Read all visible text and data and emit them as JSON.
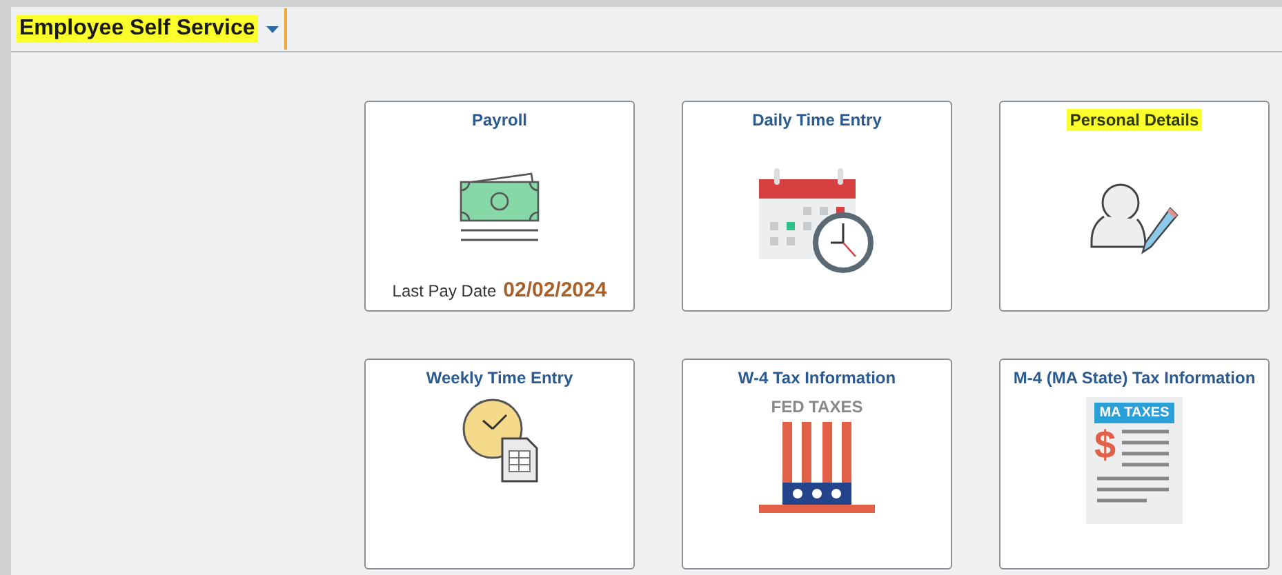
{
  "header": {
    "title": "Employee Self Service",
    "highlighted": true
  },
  "tiles": [
    {
      "title": "Payroll",
      "kind": "money",
      "highlighted": false,
      "footer_label": "Last Pay Date",
      "footer_value": "02/02/2024"
    },
    {
      "title": "Daily Time Entry",
      "kind": "calendar",
      "highlighted": false
    },
    {
      "title": "Personal Details",
      "kind": "person",
      "highlighted": true
    },
    {
      "title": "Weekly Time Entry",
      "kind": "timesheet",
      "highlighted": false
    },
    {
      "title": "W-4 Tax Information",
      "kind": "hat",
      "highlighted": false,
      "icon_text": "FED TAXES"
    },
    {
      "title": "M-4 (MA State) Tax Information",
      "kind": "document",
      "highlighted": false,
      "icon_text": "MA TAXES",
      "icon_symbol": "$"
    }
  ]
}
